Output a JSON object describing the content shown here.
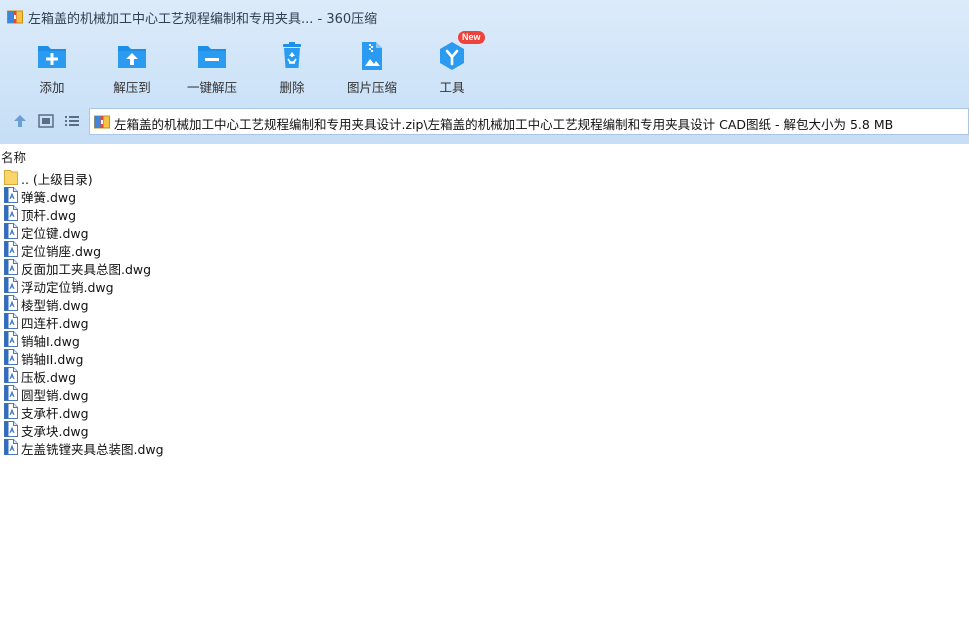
{
  "window": {
    "title": "左箱盖的机械加工中心工艺规程编制和专用夹具... - 360压缩"
  },
  "toolbar": {
    "buttons": [
      {
        "label": "添加",
        "icon": "add-archive-icon"
      },
      {
        "label": "解压到",
        "icon": "extract-to-icon"
      },
      {
        "label": "一键解压",
        "icon": "one-click-extract-icon"
      },
      {
        "label": "删除",
        "icon": "recycle-bin-icon"
      },
      {
        "label": "图片压缩",
        "icon": "image-compress-icon"
      },
      {
        "label": "工具",
        "icon": "tools-icon",
        "badge": "New"
      }
    ]
  },
  "navigation": {
    "up_icon": "up-arrow-icon",
    "thumbnail_view_icon": "thumbnail-view-icon",
    "list_view_icon": "list-view-icon"
  },
  "address": {
    "path": "左箱盖的机械加工中心工艺规程编制和专用夹具设计.zip\\左箱盖的机械加工中心工艺规程编制和专用夹具设计 CAD图纸 - 解包大小为 5.8 MB"
  },
  "list": {
    "column_name": "名称",
    "parent_dir": ".. (上级目录)",
    "files": [
      "弹簧.dwg",
      "顶杆.dwg",
      "定位键.dwg",
      "定位销座.dwg",
      "反面加工夹具总图.dwg",
      "浮动定位销.dwg",
      "棱型销.dwg",
      "四连杆.dwg",
      "销轴I.dwg",
      "销轴II.dwg",
      "压板.dwg",
      "圆型销.dwg",
      "支承杆.dwg",
      "支承块.dwg",
      "左盖铣镗夹具总装图.dwg"
    ]
  },
  "colors": {
    "header_bg": "#cfe4f8",
    "icon_blue": "#1e8fe8",
    "badge_red": "#f0413b"
  }
}
